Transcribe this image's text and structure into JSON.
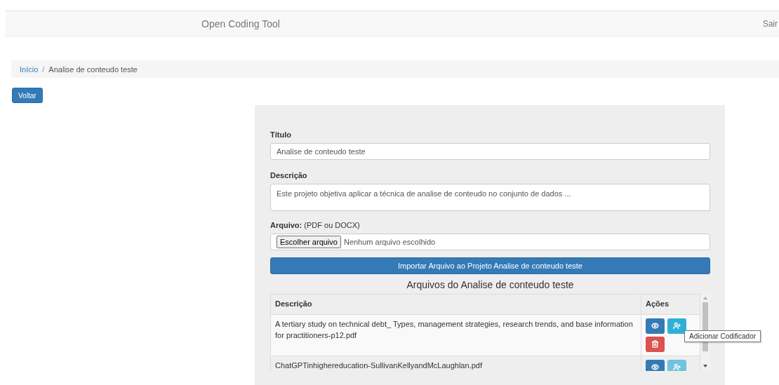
{
  "navbar": {
    "brand": "Open Coding Tool",
    "logout": "Sair"
  },
  "breadcrumb_separator": "/",
  "breadcrumb": [
    {
      "label": "Início",
      "link": true
    },
    {
      "label": "Analise de conteudo teste",
      "link": false
    }
  ],
  "back_button": "Voltar",
  "form": {
    "title_label": "Título",
    "title_value": "Analise de conteudo teste",
    "description_label": "Descrição",
    "description_value": "Este projeto objetiva aplicar a técnica de analise de conteudo no conjunto de dados ...",
    "file_label": "Arquivo:",
    "file_hint": "(PDF ou DOCX)",
    "file_button": "Escolher arquivo",
    "file_status": "Nenhum arquivo escolhido",
    "import_button": "Importar Arquivo ao Projeto Analise de conteudo teste"
  },
  "files": {
    "heading": "Arquivos do Analise de conteudo teste",
    "columns": [
      "Descrição",
      "Ações"
    ],
    "rows": [
      {
        "description": "A tertiary study on technical debt_ Types, management strategies, research trends, and base information for practitioners-p12.pdf",
        "add_disabled": false
      },
      {
        "description": "ChatGPTinhighereducation-SullivanKellyandMcLaughlan.pdf",
        "add_disabled": true
      }
    ],
    "tooltip": "Adicionar Codificador"
  }
}
